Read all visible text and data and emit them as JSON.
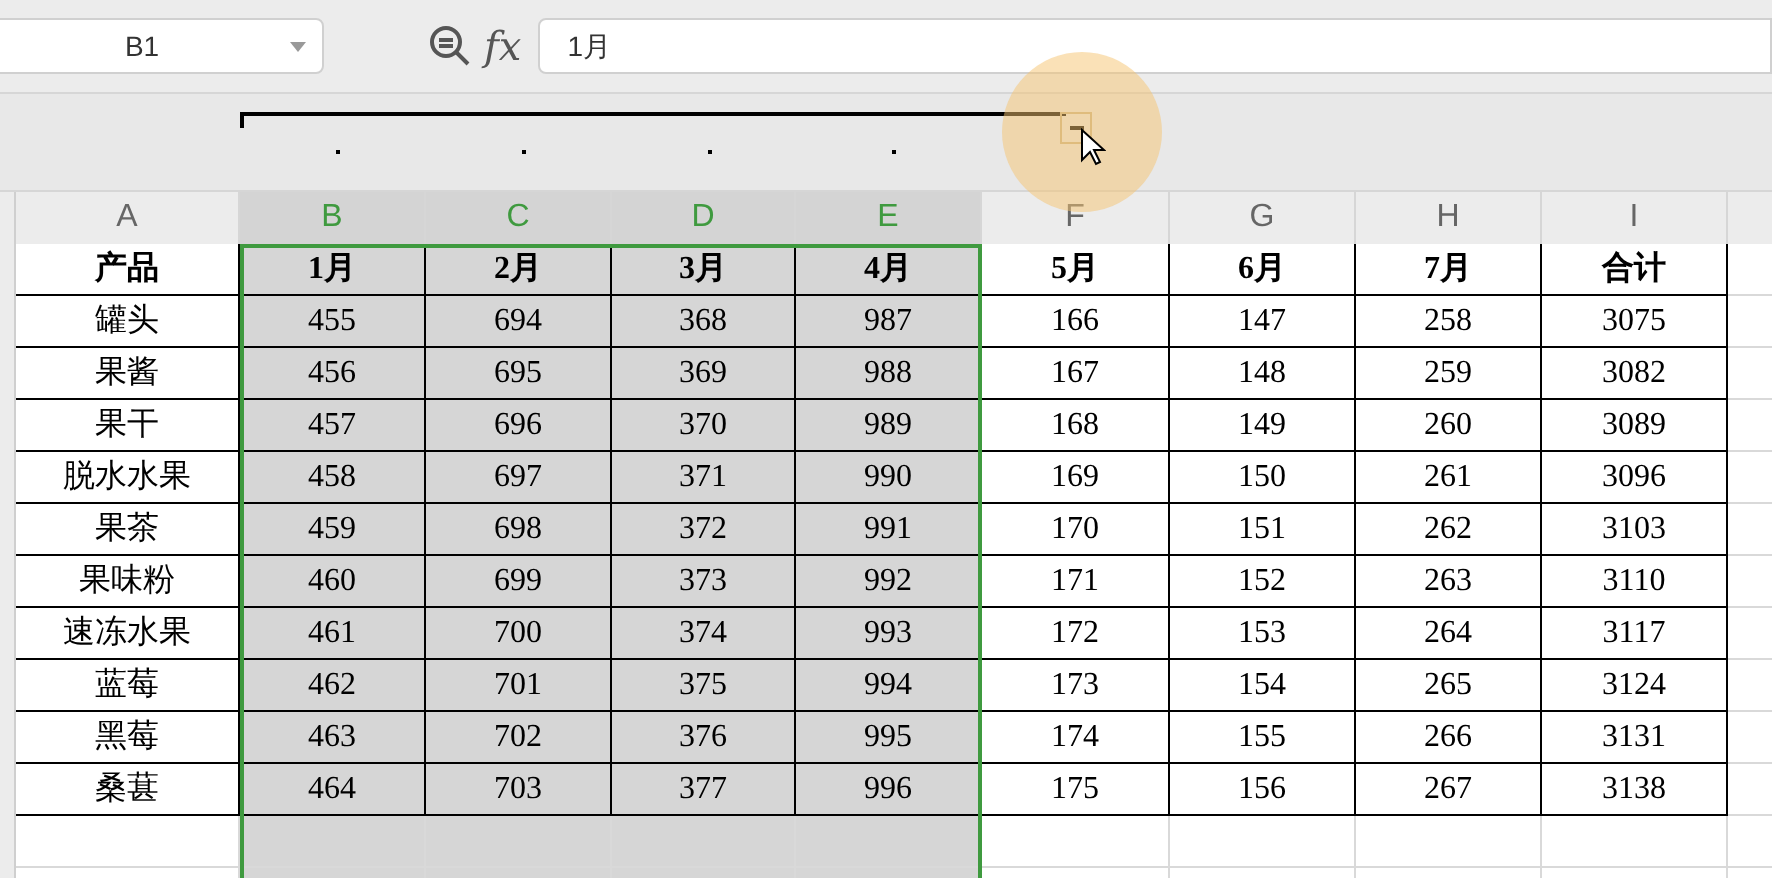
{
  "name_box": {
    "value": "B1"
  },
  "formula_bar": {
    "function_label": "fx",
    "value": "1月"
  },
  "outline": {
    "expanded": true
  },
  "columns": [
    {
      "label": "A",
      "selected": false
    },
    {
      "label": "B",
      "selected": true
    },
    {
      "label": "C",
      "selected": true
    },
    {
      "label": "D",
      "selected": true
    },
    {
      "label": "E",
      "selected": true
    },
    {
      "label": "F",
      "selected": false
    },
    {
      "label": "G",
      "selected": false
    },
    {
      "label": "H",
      "selected": false
    },
    {
      "label": "I",
      "selected": false
    }
  ],
  "rows": [
    [
      "产品",
      "1月",
      "2月",
      "3月",
      "4月",
      "5月",
      "6月",
      "7月",
      "合计"
    ],
    [
      "罐头",
      "455",
      "694",
      "368",
      "987",
      "166",
      "147",
      "258",
      "3075"
    ],
    [
      "果酱",
      "456",
      "695",
      "369",
      "988",
      "167",
      "148",
      "259",
      "3082"
    ],
    [
      "果干",
      "457",
      "696",
      "370",
      "989",
      "168",
      "149",
      "260",
      "3089"
    ],
    [
      "脱水水果",
      "458",
      "697",
      "371",
      "990",
      "169",
      "150",
      "261",
      "3096"
    ],
    [
      "果茶",
      "459",
      "698",
      "372",
      "991",
      "170",
      "151",
      "262",
      "3103"
    ],
    [
      "果味粉",
      "460",
      "699",
      "373",
      "992",
      "171",
      "152",
      "263",
      "3110"
    ],
    [
      "速冻水果",
      "461",
      "700",
      "374",
      "993",
      "172",
      "153",
      "264",
      "3117"
    ],
    [
      "蓝莓",
      "462",
      "701",
      "375",
      "994",
      "173",
      "154",
      "265",
      "3124"
    ],
    [
      "黑莓",
      "463",
      "702",
      "376",
      "995",
      "174",
      "155",
      "266",
      "3131"
    ],
    [
      "桑葚",
      "464",
      "703",
      "377",
      "996",
      "175",
      "156",
      "267",
      "3138"
    ]
  ]
}
